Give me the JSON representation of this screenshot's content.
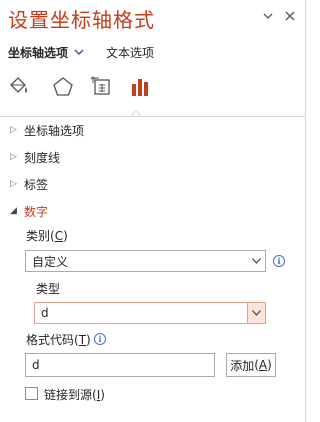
{
  "pane": {
    "title": "设置坐标轴格式"
  },
  "tabs": [
    {
      "label": "坐标轴选项"
    },
    {
      "label": "文本选项"
    }
  ],
  "sections": [
    {
      "label": "坐标轴选项",
      "expanded": false
    },
    {
      "label": "刻度线",
      "expanded": false
    },
    {
      "label": "标签",
      "expanded": false
    },
    {
      "label": "数字",
      "expanded": true
    }
  ],
  "number": {
    "category_label": "类别",
    "category_key": "C",
    "category_value": "自定义",
    "type_label": "类型",
    "type_value": "d",
    "format_code_label": "格式代码",
    "format_code_key": "T",
    "format_code_value": "d",
    "add_button_label": "添加",
    "add_button_key": "A",
    "link_source_label": "链接到源",
    "link_source_key": "I",
    "link_source_checked": false
  },
  "colors": {
    "accent": "#c43e1c",
    "chart_bars": "#c43e1c",
    "info": "#4472c4"
  },
  "icons": {
    "pin": "dropdown-pin-icon",
    "close": "close-icon",
    "fill_line": "paint-bucket-icon",
    "effects": "pentagon-icon",
    "size_props": "size-properties-icon",
    "axis_options": "bar-chart-icon"
  }
}
